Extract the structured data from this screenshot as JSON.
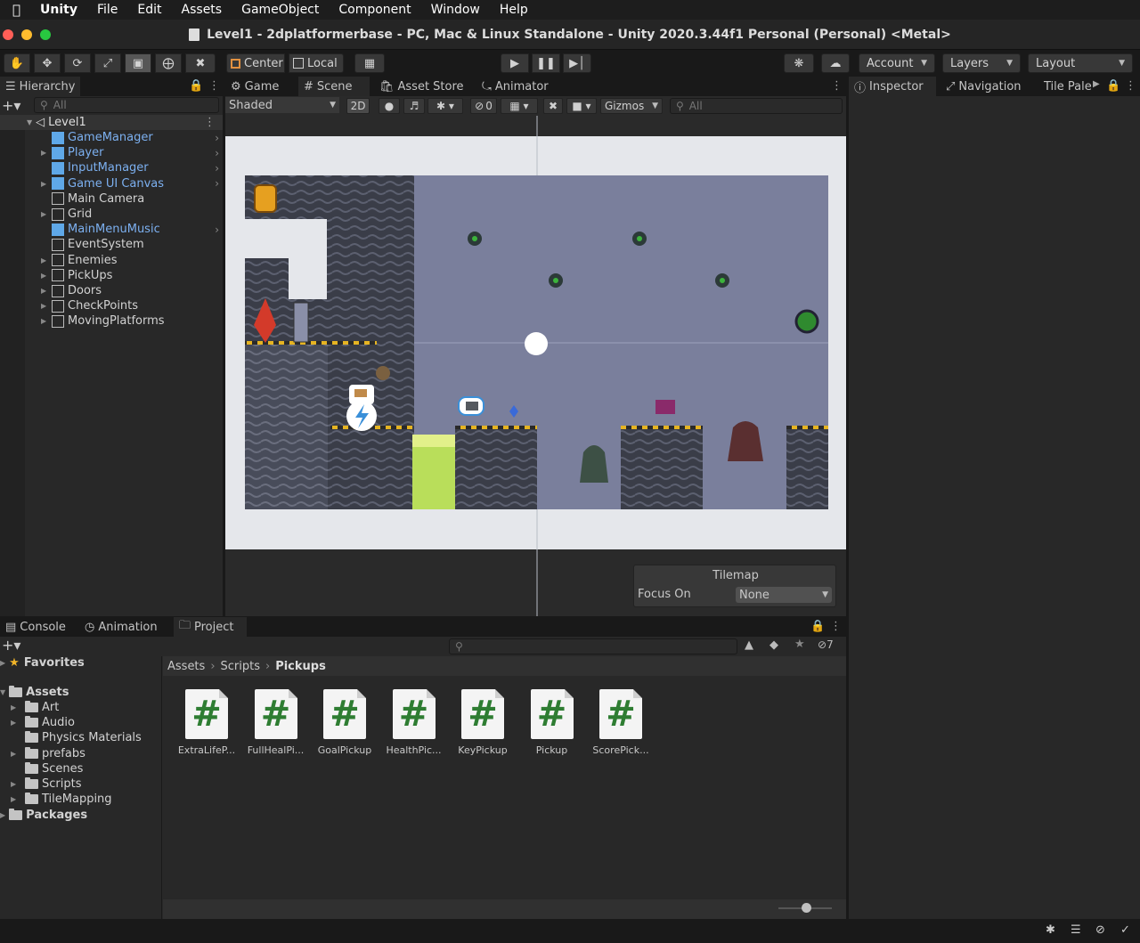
{
  "menubar": {
    "app": "Unity",
    "items": [
      "File",
      "Edit",
      "Assets",
      "GameObject",
      "Component",
      "Window",
      "Help"
    ]
  },
  "window": {
    "title": "Level1 - 2dplatformerbase - PC, Mac & Linux Standalone - Unity 2020.3.44f1 Personal (Personal) <Metal>"
  },
  "toolbar": {
    "pivot_center": "Center",
    "pivot_local": "Local",
    "account": "Account",
    "layers": "Layers",
    "layout": "Layout"
  },
  "hierarchy": {
    "tab": "Hierarchy",
    "search_placeholder": "All",
    "scene": "Level1",
    "items": [
      {
        "label": "GameManager",
        "prefab": true
      },
      {
        "label": "Player",
        "prefab": true
      },
      {
        "label": "InputManager",
        "prefab": true
      },
      {
        "label": "Game UI Canvas",
        "prefab": true
      },
      {
        "label": "Main Camera",
        "prefab": false
      },
      {
        "label": "Grid",
        "prefab": false
      },
      {
        "label": "MainMenuMusic",
        "prefab": true
      },
      {
        "label": "EventSystem",
        "prefab": false
      },
      {
        "label": "Enemies",
        "prefab": false
      },
      {
        "label": "PickUps",
        "prefab": false
      },
      {
        "label": "Doors",
        "prefab": false
      },
      {
        "label": "CheckPoints",
        "prefab": false
      },
      {
        "label": "MovingPlatforms",
        "prefab": false
      }
    ]
  },
  "scene_view": {
    "tabs": [
      "Game",
      "Scene",
      "Asset Store",
      "Animator"
    ],
    "shading": "Shaded",
    "mode_2d": "2D",
    "hidden_count": "0",
    "gizmos": "Gizmos",
    "search_placeholder": "All",
    "overlay_title": "Tilemap",
    "overlay_focus_label": "Focus On",
    "overlay_focus_value": "None"
  },
  "right_tabs": [
    "Inspector",
    "Navigation",
    "Tile Pale"
  ],
  "bottom": {
    "tabs": [
      "Console",
      "Animation",
      "Project"
    ],
    "favorites": "Favorites",
    "assets_root": "Assets",
    "folders": [
      "Art",
      "Audio",
      "Physics Materials",
      "prefabs",
      "Scenes",
      "Scripts",
      "TileMapping"
    ],
    "packages": "Packages",
    "breadcrumb": [
      "Assets",
      "Scripts",
      "Pickups"
    ],
    "hidden_count": "7",
    "assets": [
      "ExtraLifeP...",
      "FullHealPi...",
      "GoalPickup",
      "HealthPic...",
      "KeyPickup",
      "Pickup",
      "ScorePick..."
    ]
  },
  "colors": {
    "accent": "#2c5d87",
    "prefab_text": "#7cb0f0",
    "script_hash": "#2e7d32"
  }
}
